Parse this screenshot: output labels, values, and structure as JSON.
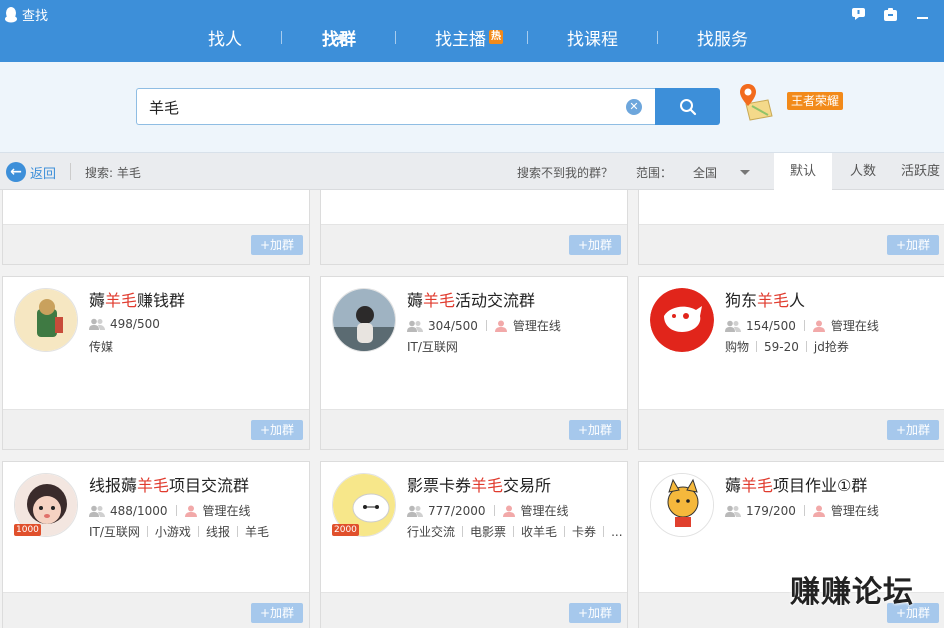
{
  "app": {
    "title": "查找"
  },
  "tabs": [
    {
      "label": "找人"
    },
    {
      "label": "找群",
      "active": true
    },
    {
      "label": "找主播",
      "badge": "热"
    },
    {
      "label": "找课程"
    },
    {
      "label": "找服务"
    }
  ],
  "search": {
    "value": "羊毛",
    "tag": "王者荣耀"
  },
  "filter": {
    "back_label": "返回",
    "search_label": "搜索: 羊毛",
    "not_found": "搜索不到我的群？",
    "range_label": "范围：",
    "range_value": "全国",
    "sort_tabs": [
      "默认",
      "人数",
      "活跃度"
    ]
  },
  "join_label": "+加群",
  "groups": [
    {
      "name_pre": "薅",
      "name_hl": "羊毛",
      "name_post": "赚钱群",
      "members": "498/500",
      "admin": "",
      "tags": [
        "传媒"
      ]
    },
    {
      "name_pre": "薅",
      "name_hl": "羊毛",
      "name_post": "活动交流群",
      "members": "304/500",
      "admin": "管理在线",
      "tags": [
        "IT/互联网"
      ]
    },
    {
      "name_pre": "狗东",
      "name_hl": "羊毛",
      "name_post": "人",
      "members": "154/500",
      "admin": "管理在线",
      "tags": [
        "购物",
        "59-20",
        "jd抢券"
      ]
    },
    {
      "name_pre": "线报薅",
      "name_hl": "羊毛",
      "name_post": "项目交流群",
      "members": "488/1000",
      "admin": "管理在线",
      "tags": [
        "IT/互联网",
        "小游戏",
        "线报",
        "羊毛"
      ],
      "level": "1000"
    },
    {
      "name_pre": "影票卡券",
      "name_hl": "羊毛",
      "name_post": "交易所",
      "members": "777/2000",
      "admin": "管理在线",
      "tags": [
        "行业交流",
        "电影票",
        "收羊毛",
        "卡券",
        "..."
      ],
      "level": "2000"
    },
    {
      "name_pre": "薅",
      "name_hl": "羊毛",
      "name_post": "项目作业①群",
      "members": "179/200",
      "admin": "管理在线",
      "tags": []
    }
  ],
  "watermark": "赚赚论坛",
  "colors": {
    "brand": "#3d8fd9",
    "highlight": "#e03b2e",
    "badge": "#f28a1a"
  }
}
